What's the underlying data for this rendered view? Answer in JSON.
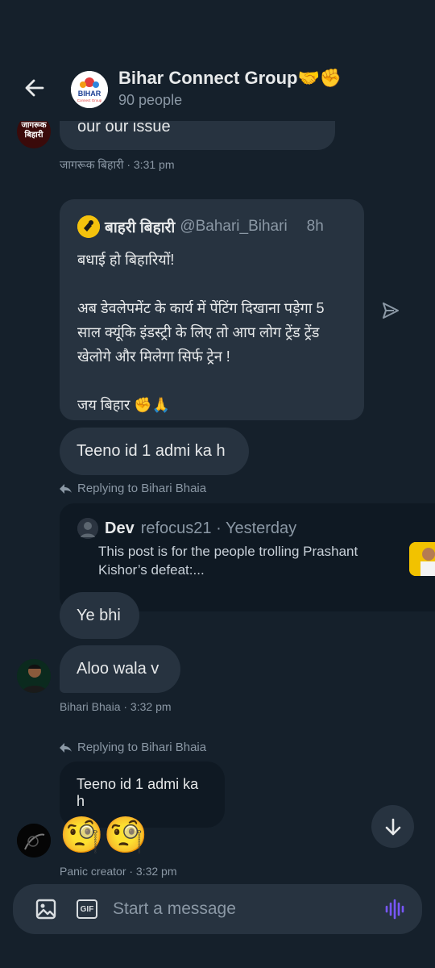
{
  "header": {
    "title": "Bihar Connect Group🤝✊",
    "subtitle": "90 people",
    "avatar_text": "BIHAR",
    "avatar_subtext": "Connect Group"
  },
  "messages": {
    "m1": {
      "text": "our our issue",
      "avatar_text": "जागरूक\nबिहारी",
      "meta": "जागरूक बिहारी · 3:31 pm"
    },
    "quote": {
      "name": "बाहरी बिहारी",
      "handle": "@Bahari_Bihari",
      "time": "8h",
      "text": "बधाई हो बिहारियों!\n\nअब डेवलेपमेंट के कार्य में पेंटिंग दिखाना पड़ेगा 5 साल क्यूंकि इंडस्ट्री के लिए तो आप लोग ट्रेंड ट्रेंड खेलोगे और मिलेगा सिर्फ ट्रेन !\n\nजय बिहार ✊🙏"
    },
    "m2": {
      "text": "Teeno id 1 admi ka h"
    },
    "reply1": {
      "label": "Replying to Bihari Bhaia"
    },
    "embedded": {
      "name": "Dev",
      "sub": "refocus21 · Yesterday",
      "text": "This post is for the people trolling Prashant Kishor’s defeat:..."
    },
    "m3": {
      "text": "Ye bhi"
    },
    "m4": {
      "text": "Aloo wala v",
      "meta": "Bihari Bhaia · 3:32 pm"
    },
    "reply2": {
      "label": "Replying to Bihari Bhaia"
    },
    "m5": {
      "text": "Teeno id 1 admi ka h"
    },
    "m6": {
      "text": "🧐🧐",
      "meta": "Panic creator · 3:32 pm"
    }
  },
  "composer": {
    "placeholder": "Start a message",
    "gif_label": "GIF"
  },
  "colors": {
    "background": "#15202b",
    "bubble": "#273340",
    "accent": "#1d9bf0",
    "voice": "#7856ff"
  }
}
